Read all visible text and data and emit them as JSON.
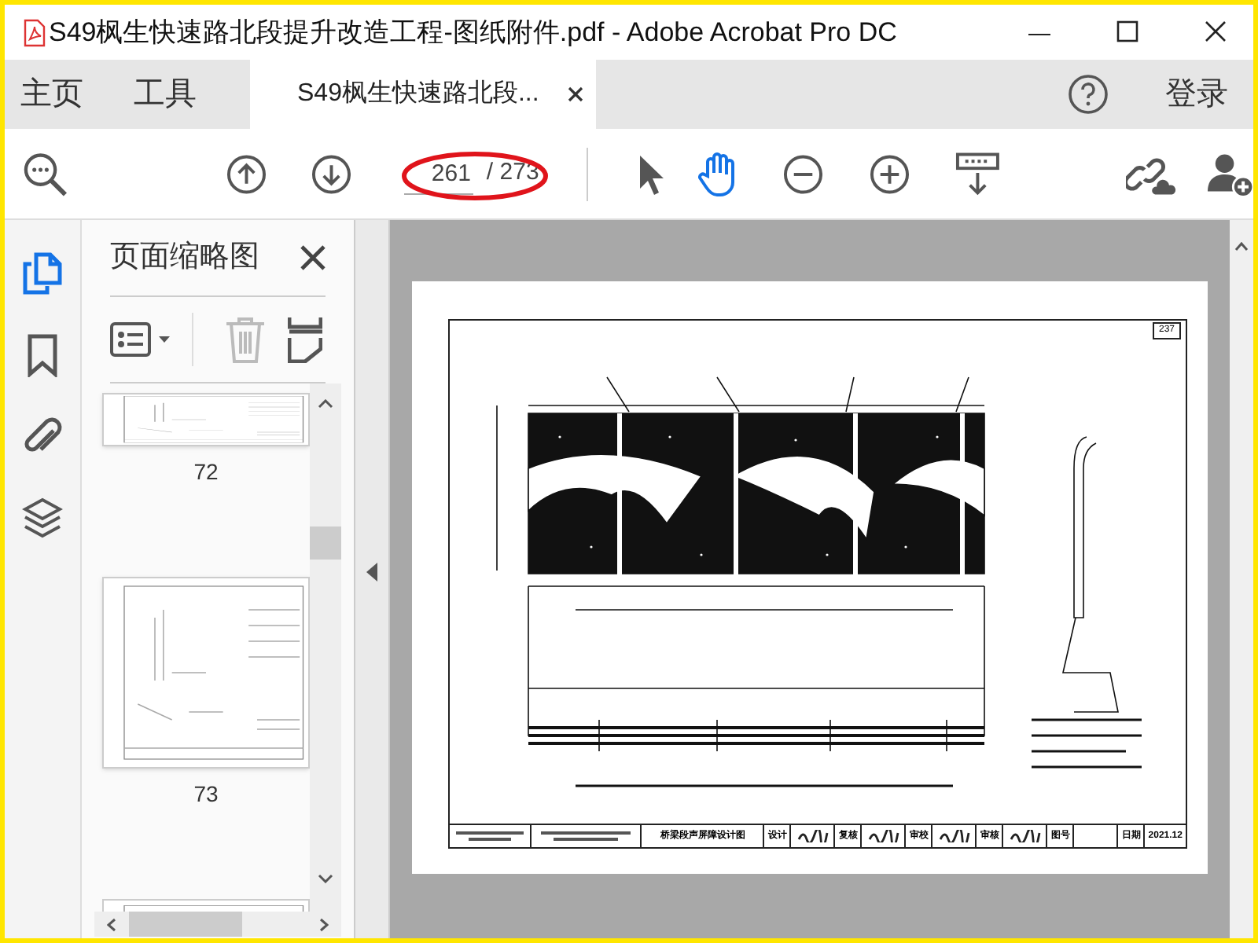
{
  "window": {
    "title": "S49枫生快速路北段提升改造工程-图纸附件.pdf - Adobe Acrobat Pro DC"
  },
  "menu": [
    {
      "label": "主页"
    },
    {
      "label": "工具"
    }
  ],
  "document_tab": {
    "label": "S49枫生快速路北段...",
    "selected": true
  },
  "sign_in": "登录",
  "toolbar": {
    "page_number": "261",
    "page_total": "/ 273",
    "tools": [
      {
        "kind": "select",
        "selected": false
      },
      {
        "kind": "hand",
        "selected": true
      }
    ]
  },
  "left_rail": [
    {
      "kind": "pages",
      "selected": true
    },
    {
      "kind": "bookmarks",
      "selected": false
    },
    {
      "kind": "attachments",
      "selected": false
    },
    {
      "kind": "layers",
      "selected": false
    }
  ],
  "thumbnail_panel": {
    "title": "页面缩略图",
    "thumbnails": [
      {
        "label": "72"
      },
      {
        "label": "73"
      }
    ]
  },
  "document": {
    "page_tag": "237",
    "title_block": {
      "drawing_title": "桥梁段声屏障设计图",
      "fields": [
        {
          "label": "设计"
        },
        {
          "label": "复核"
        },
        {
          "label": "审校"
        },
        {
          "label": "审核"
        },
        {
          "label": "图号"
        },
        {
          "label": "日期",
          "value": "2021.12"
        }
      ]
    }
  }
}
